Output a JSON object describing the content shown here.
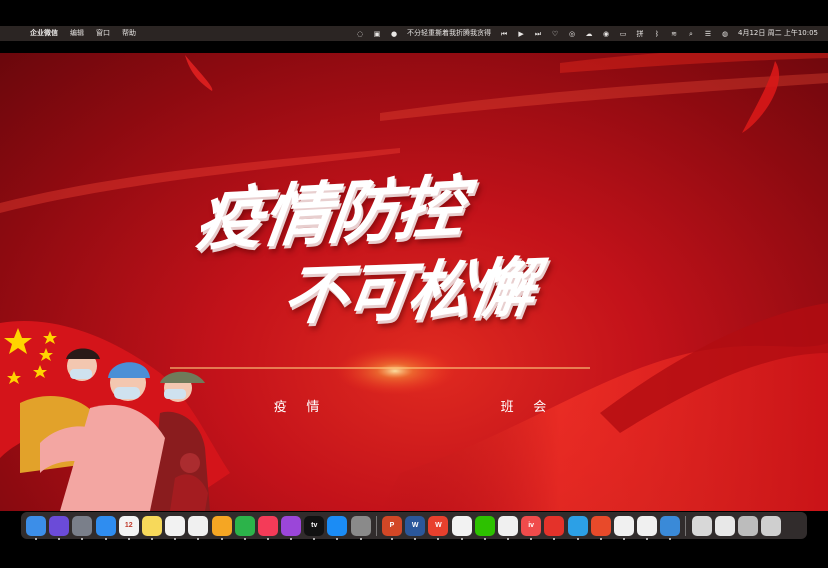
{
  "menubar": {
    "app_name": "企业微信",
    "menus": [
      "编辑",
      "窗口",
      "帮助"
    ],
    "now_playing": "不分轻重撕着我折腾我贪得",
    "datetime": "4月12日 周二 上午10:05"
  },
  "slide": {
    "title_line1": "疫情防控",
    "title_line2": "不可松懈",
    "subtitle_left": "疫 情",
    "subtitle_right": "班 会"
  },
  "dock": {
    "apps": [
      {
        "name": "finder-icon",
        "label": "",
        "color": "#3c8ee8"
      },
      {
        "name": "siri-icon",
        "label": "",
        "color": "#6b4bd8"
      },
      {
        "name": "launchpad-icon",
        "label": "",
        "color": "#7a7f8a"
      },
      {
        "name": "safari-icon",
        "label": "",
        "color": "#2f8df0"
      },
      {
        "name": "calendar-icon",
        "label": "12",
        "color": "#f4f4f4"
      },
      {
        "name": "notes-icon",
        "label": "",
        "color": "#f7d95a"
      },
      {
        "name": "reminders-icon",
        "label": "",
        "color": "#f2f2f2"
      },
      {
        "name": "photos-icon",
        "label": "",
        "color": "#f0f0f0"
      },
      {
        "name": "pages-icon",
        "label": "",
        "color": "#f5a623"
      },
      {
        "name": "numbers-icon",
        "label": "",
        "color": "#2cb34a"
      },
      {
        "name": "music-icon",
        "label": "",
        "color": "#f43b58"
      },
      {
        "name": "podcasts-icon",
        "label": "",
        "color": "#9b46d9"
      },
      {
        "name": "tv-icon",
        "label": "tv",
        "color": "#111111"
      },
      {
        "name": "app-store-icon",
        "label": "",
        "color": "#1b8cf5"
      },
      {
        "name": "system-preferences-icon",
        "label": "",
        "color": "#8a8a8a"
      },
      {
        "name": "powerpoint-icon",
        "label": "P",
        "color": "#d24726"
      },
      {
        "name": "word-icon",
        "label": "W",
        "color": "#2b579a"
      },
      {
        "name": "wps-icon",
        "label": "W",
        "color": "#e8402d"
      },
      {
        "name": "chrome-icon",
        "label": "",
        "color": "#f2f2f2"
      },
      {
        "name": "wechat-icon",
        "label": "",
        "color": "#2dc100"
      },
      {
        "name": "video-app-icon",
        "label": "",
        "color": "#f0f0f0"
      },
      {
        "name": "iqiyi-icon",
        "label": "iv",
        "color": "#f04b4b"
      },
      {
        "name": "netease-music-icon",
        "label": "",
        "color": "#e4322a"
      },
      {
        "name": "wecom-icon",
        "label": "",
        "color": "#2ca0e6"
      },
      {
        "name": "tool-app-icon",
        "label": "",
        "color": "#e84a2a"
      },
      {
        "name": "qq-icon",
        "label": "",
        "color": "#f0f0f0"
      },
      {
        "name": "quark-icon",
        "label": "",
        "color": "#f0f0f0"
      },
      {
        "name": "photo-editor-icon",
        "label": "",
        "color": "#3a8ad8"
      },
      {
        "name": "recent-document-1-icon",
        "label": "",
        "color": "#d8d8d8"
      },
      {
        "name": "recent-document-2-icon",
        "label": "",
        "color": "#e8e8e8"
      },
      {
        "name": "recent-document-3-icon",
        "label": "",
        "color": "#bcbcbc"
      },
      {
        "name": "trash-icon",
        "label": "",
        "color": "#cfcfcf"
      }
    ]
  },
  "colors": {
    "menubar": "#2b2523",
    "slide_red": "#c3121a",
    "flag_star": "#ffd400"
  }
}
